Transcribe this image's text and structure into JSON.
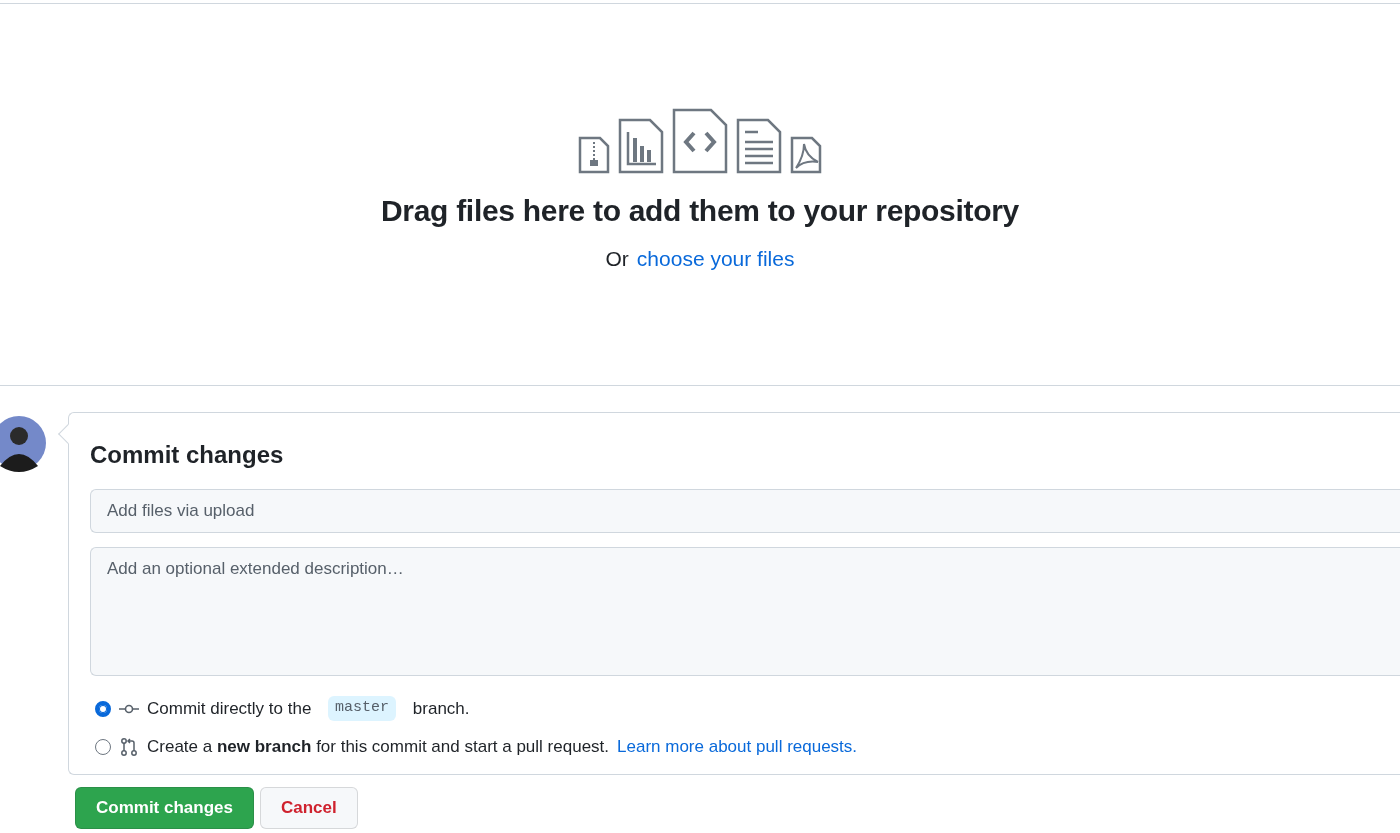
{
  "dropzone": {
    "title": "Drag files here to add them to your repository",
    "prompt": "Or",
    "link": "choose your files"
  },
  "commit": {
    "heading": "Commit changes",
    "summary_placeholder": "Add files via upload",
    "description_placeholder": "Add an optional extended description…",
    "options": [
      {
        "kind": "direct",
        "selected": true,
        "before": "Commit directly to the ",
        "branch": "master",
        "after": " branch."
      },
      {
        "kind": "new_branch",
        "selected": false,
        "text": "Create a **new branch** for this commit and start a pull request.",
        "link": "Learn more about pull requests."
      }
    ]
  },
  "buttons": [
    {
      "kind": "primary",
      "label": "Commit changes"
    },
    {
      "kind": "cancel",
      "label": "Cancel"
    }
  ]
}
